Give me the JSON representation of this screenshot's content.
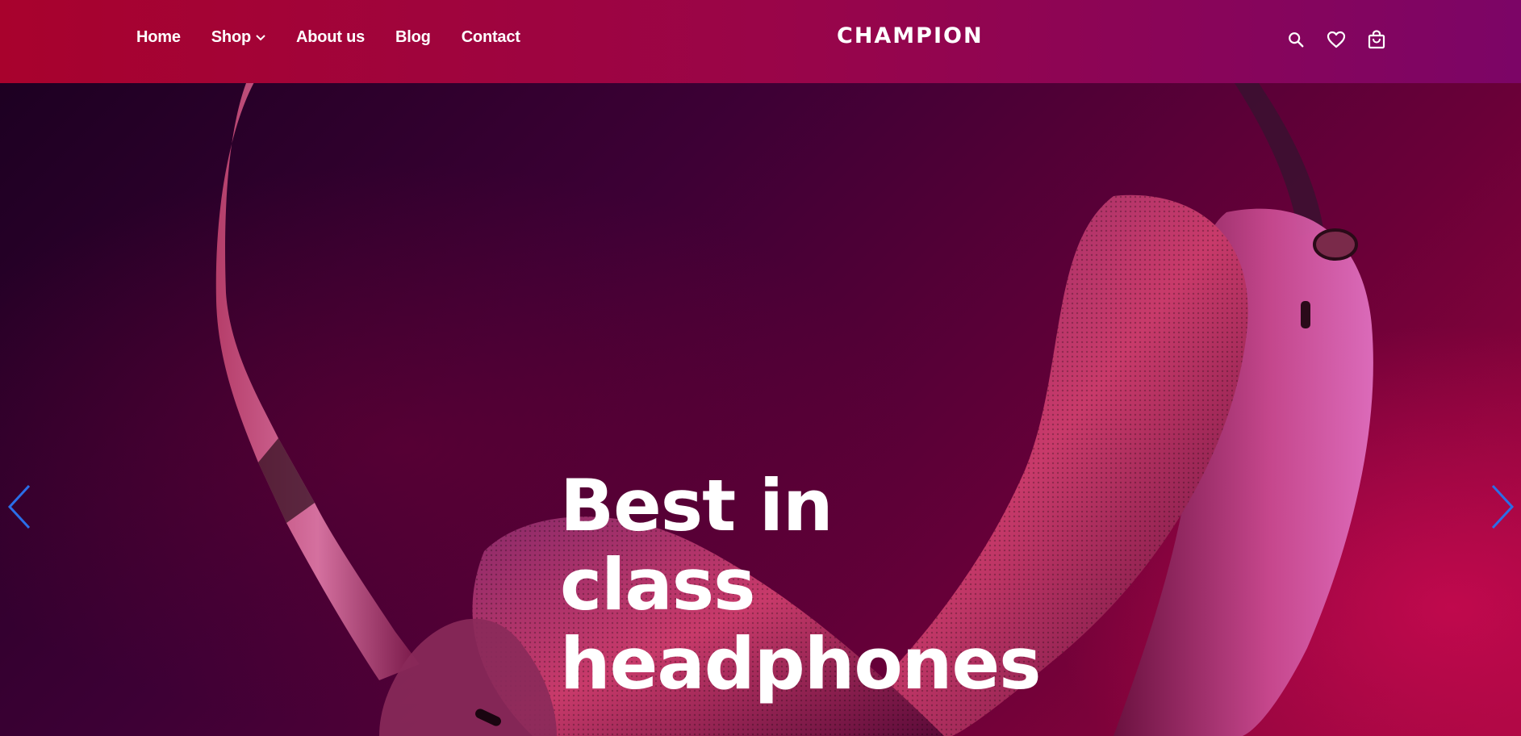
{
  "header": {
    "logo": "CHAMPION",
    "nav": [
      "Home",
      "Shop",
      "About us",
      "Blog",
      "Contact"
    ]
  },
  "icons": {
    "search": "search-icon",
    "wishlist": "heart-icon",
    "cart": "shopping-bag-icon",
    "shop_dropdown": "chevron-down-icon",
    "prev": "chevron-left-icon",
    "next": "chevron-right-icon"
  },
  "hero": {
    "line1": "Best in class",
    "line2": "headphones"
  },
  "colors": {
    "header_start": "#a8022d",
    "header_end": "#7c0566",
    "arrow": "#2a6ee8",
    "text": "#ffffff"
  }
}
